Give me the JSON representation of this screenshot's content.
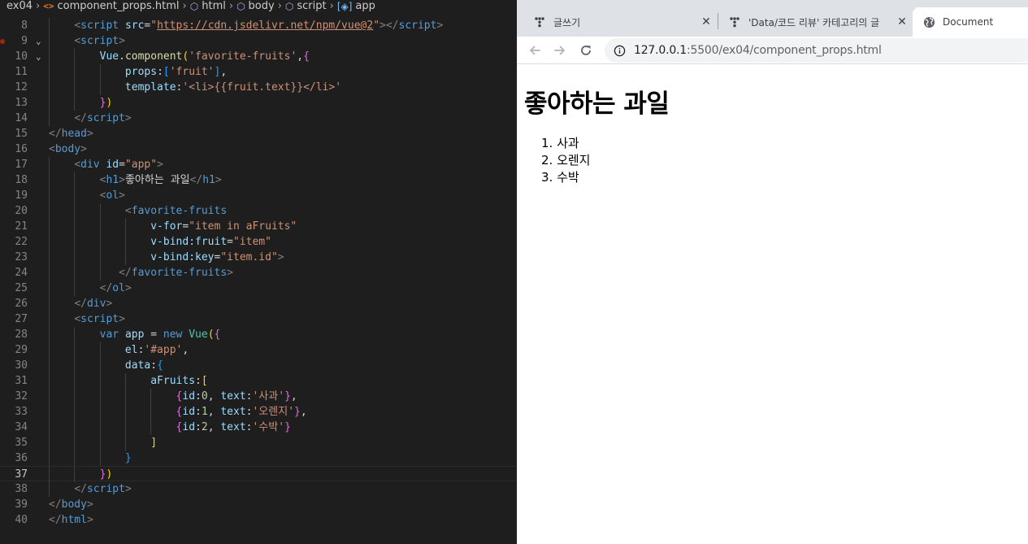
{
  "breadcrumb": [
    {
      "label": "ex04",
      "icon": "none"
    },
    {
      "label": "component_props.html",
      "icon": "html-file-icon"
    },
    {
      "label": "html",
      "icon": "element-icon"
    },
    {
      "label": "body",
      "icon": "element-icon"
    },
    {
      "label": "script",
      "icon": "element-icon"
    },
    {
      "label": "app",
      "icon": "variable-icon"
    }
  ],
  "editor": {
    "current_line": 37,
    "breakpoint_line": 9,
    "lines": [
      {
        "n": 8,
        "tokens": [
          [
            "    ",
            "txt"
          ],
          [
            "<",
            "punc"
          ],
          [
            "script",
            "tag"
          ],
          [
            " ",
            "txt"
          ],
          [
            "src",
            "attr"
          ],
          [
            "=",
            "txt"
          ],
          [
            "\"",
            "str"
          ],
          [
            "https://cdn.jsdelivr.net/npm/vue@2",
            "url"
          ],
          [
            "\"",
            "str"
          ],
          [
            "></",
            "punc"
          ],
          [
            "script",
            "tag"
          ],
          [
            ">",
            "punc"
          ]
        ]
      },
      {
        "n": 9,
        "tokens": [
          [
            "    ",
            "txt"
          ],
          [
            "<",
            "punc"
          ],
          [
            "script",
            "tag"
          ],
          [
            ">",
            "punc"
          ]
        ]
      },
      {
        "n": 10,
        "tokens": [
          [
            "        ",
            "txt"
          ],
          [
            "Vue",
            "var"
          ],
          [
            ".",
            "txt"
          ],
          [
            "component",
            "fn"
          ],
          [
            "(",
            "b1"
          ],
          [
            "'favorite-fruits'",
            "str"
          ],
          [
            ",",
            "txt"
          ],
          [
            "{",
            "b2"
          ]
        ]
      },
      {
        "n": 11,
        "tokens": [
          [
            "            ",
            "txt"
          ],
          [
            "props",
            "var"
          ],
          [
            ":",
            "txt"
          ],
          [
            "[",
            "b3"
          ],
          [
            "'fruit'",
            "str"
          ],
          [
            "]",
            "b3"
          ],
          [
            ",",
            "txt"
          ]
        ]
      },
      {
        "n": 12,
        "tokens": [
          [
            "            ",
            "txt"
          ],
          [
            "template",
            "var"
          ],
          [
            ":",
            "txt"
          ],
          [
            "'<li>{{fruit.text}}</li>'",
            "str"
          ]
        ]
      },
      {
        "n": 13,
        "tokens": [
          [
            "        ",
            "txt"
          ],
          [
            "}",
            "b2"
          ],
          [
            ")",
            "b1"
          ]
        ]
      },
      {
        "n": 14,
        "tokens": [
          [
            "    ",
            "txt"
          ],
          [
            "</",
            "punc"
          ],
          [
            "script",
            "tag"
          ],
          [
            ">",
            "punc"
          ]
        ]
      },
      {
        "n": 15,
        "tokens": [
          [
            "</",
            "punc"
          ],
          [
            "head",
            "tag"
          ],
          [
            ">",
            "punc"
          ]
        ]
      },
      {
        "n": 16,
        "tokens": [
          [
            "<",
            "punc"
          ],
          [
            "body",
            "tag"
          ],
          [
            ">",
            "punc"
          ]
        ]
      },
      {
        "n": 17,
        "tokens": [
          [
            "    ",
            "txt"
          ],
          [
            "<",
            "punc"
          ],
          [
            "div",
            "tag"
          ],
          [
            " ",
            "txt"
          ],
          [
            "id",
            "attr"
          ],
          [
            "=",
            "txt"
          ],
          [
            "\"app\"",
            "str"
          ],
          [
            ">",
            "punc"
          ]
        ]
      },
      {
        "n": 18,
        "tokens": [
          [
            "        ",
            "txt"
          ],
          [
            "<",
            "punc"
          ],
          [
            "h1",
            "tag"
          ],
          [
            ">",
            "punc"
          ],
          [
            "좋아하는 과일",
            "txt"
          ],
          [
            "</",
            "punc"
          ],
          [
            "h1",
            "tag"
          ],
          [
            ">",
            "punc"
          ]
        ]
      },
      {
        "n": 19,
        "tokens": [
          [
            "        ",
            "txt"
          ],
          [
            "<",
            "punc"
          ],
          [
            "ol",
            "tag"
          ],
          [
            ">",
            "punc"
          ]
        ]
      },
      {
        "n": 20,
        "tokens": [
          [
            "            ",
            "txt"
          ],
          [
            "<",
            "punc"
          ],
          [
            "favorite-fruits",
            "tag"
          ]
        ]
      },
      {
        "n": 21,
        "tokens": [
          [
            "                ",
            "txt"
          ],
          [
            "v-for",
            "attr"
          ],
          [
            "=",
            "txt"
          ],
          [
            "\"item in aFruits\"",
            "str"
          ]
        ]
      },
      {
        "n": 22,
        "tokens": [
          [
            "                ",
            "txt"
          ],
          [
            "v-bind:fruit",
            "attr"
          ],
          [
            "=",
            "txt"
          ],
          [
            "\"item\"",
            "str"
          ]
        ]
      },
      {
        "n": 23,
        "tokens": [
          [
            "                ",
            "txt"
          ],
          [
            "v-bind:key",
            "attr"
          ],
          [
            "=",
            "txt"
          ],
          [
            "\"item.id\"",
            "str"
          ],
          [
            ">",
            "punc"
          ]
        ]
      },
      {
        "n": 24,
        "tokens": [
          [
            "           ",
            "txt"
          ],
          [
            "</",
            "punc"
          ],
          [
            "favorite-fruits",
            "tag"
          ],
          [
            ">",
            "punc"
          ]
        ]
      },
      {
        "n": 25,
        "tokens": [
          [
            "        ",
            "txt"
          ],
          [
            "</",
            "punc"
          ],
          [
            "ol",
            "tag"
          ],
          [
            ">",
            "punc"
          ]
        ]
      },
      {
        "n": 26,
        "tokens": [
          [
            "    ",
            "txt"
          ],
          [
            "</",
            "punc"
          ],
          [
            "div",
            "tag"
          ],
          [
            ">",
            "punc"
          ]
        ]
      },
      {
        "n": 27,
        "tokens": [
          [
            "    ",
            "txt"
          ],
          [
            "<",
            "punc"
          ],
          [
            "script",
            "tag"
          ],
          [
            ">",
            "punc"
          ]
        ]
      },
      {
        "n": 28,
        "tokens": [
          [
            "        ",
            "txt"
          ],
          [
            "var",
            "kw"
          ],
          [
            " ",
            "txt"
          ],
          [
            "app",
            "var"
          ],
          [
            " = ",
            "txt"
          ],
          [
            "new",
            "kw"
          ],
          [
            " ",
            "txt"
          ],
          [
            "Vue",
            "cls"
          ],
          [
            "(",
            "b1"
          ],
          [
            "{",
            "b2"
          ]
        ]
      },
      {
        "n": 29,
        "tokens": [
          [
            "            ",
            "txt"
          ],
          [
            "el",
            "var"
          ],
          [
            ":",
            "txt"
          ],
          [
            "'#app'",
            "str"
          ],
          [
            ",",
            "txt"
          ]
        ]
      },
      {
        "n": 30,
        "tokens": [
          [
            "            ",
            "txt"
          ],
          [
            "data",
            "var"
          ],
          [
            ":",
            "txt"
          ],
          [
            "{",
            "b3"
          ]
        ]
      },
      {
        "n": 31,
        "tokens": [
          [
            "                ",
            "txt"
          ],
          [
            "aFruits",
            "var"
          ],
          [
            ":",
            "txt"
          ],
          [
            "[",
            "b1"
          ]
        ]
      },
      {
        "n": 32,
        "tokens": [
          [
            "                    ",
            "txt"
          ],
          [
            "{",
            "b2"
          ],
          [
            "id",
            "var"
          ],
          [
            ":",
            "txt"
          ],
          [
            "0",
            "num"
          ],
          [
            ", ",
            "txt"
          ],
          [
            "text",
            "var"
          ],
          [
            ":",
            "txt"
          ],
          [
            "'사과'",
            "str"
          ],
          [
            "}",
            "b2"
          ],
          [
            ",",
            "txt"
          ]
        ]
      },
      {
        "n": 33,
        "tokens": [
          [
            "                    ",
            "txt"
          ],
          [
            "{",
            "b2"
          ],
          [
            "id",
            "var"
          ],
          [
            ":",
            "txt"
          ],
          [
            "1",
            "num"
          ],
          [
            ", ",
            "txt"
          ],
          [
            "text",
            "var"
          ],
          [
            ":",
            "txt"
          ],
          [
            "'오렌지'",
            "str"
          ],
          [
            "}",
            "b2"
          ],
          [
            ",",
            "txt"
          ]
        ]
      },
      {
        "n": 34,
        "tokens": [
          [
            "                    ",
            "txt"
          ],
          [
            "{",
            "b2"
          ],
          [
            "id",
            "var"
          ],
          [
            ":",
            "txt"
          ],
          [
            "2",
            "num"
          ],
          [
            ", ",
            "txt"
          ],
          [
            "text",
            "var"
          ],
          [
            ":",
            "txt"
          ],
          [
            "'수박'",
            "str"
          ],
          [
            "}",
            "b2"
          ]
        ]
      },
      {
        "n": 35,
        "tokens": [
          [
            "                ",
            "txt"
          ],
          [
            "]",
            "b1"
          ]
        ]
      },
      {
        "n": 36,
        "tokens": [
          [
            "            ",
            "txt"
          ],
          [
            "}",
            "b3"
          ]
        ]
      },
      {
        "n": 37,
        "tokens": [
          [
            "        ",
            "txt"
          ],
          [
            "}",
            "b2"
          ],
          [
            ")",
            "b1"
          ]
        ]
      },
      {
        "n": 38,
        "tokens": [
          [
            "    ",
            "txt"
          ],
          [
            "</",
            "punc"
          ],
          [
            "script",
            "tag"
          ],
          [
            ">",
            "punc"
          ]
        ]
      },
      {
        "n": 39,
        "tokens": [
          [
            "</",
            "punc"
          ],
          [
            "body",
            "tag"
          ],
          [
            ">",
            "punc"
          ]
        ]
      },
      {
        "n": 40,
        "tokens": [
          [
            "</",
            "punc"
          ],
          [
            "html",
            "tag"
          ],
          [
            ">",
            "punc"
          ]
        ]
      }
    ]
  },
  "browser": {
    "tabs": [
      {
        "title": "글쓰기",
        "icon": "tistory-icon",
        "active": false
      },
      {
        "title": "'Data/코드 리뷰' 카테고리의 글",
        "icon": "tistory-icon",
        "active": false
      },
      {
        "title": "Document",
        "icon": "globe-icon",
        "active": true
      }
    ],
    "url_host": "127.0.0.1",
    "url_rest": ":5500/ex04/component_props.html",
    "page": {
      "heading": "좋아하는 과일",
      "items": [
        "1. 사과",
        "2. 오렌지",
        "3. 수박"
      ]
    }
  },
  "colors": {
    "editor_bg": "#1e1e1e",
    "tabstrip_bg": "#dee1e6",
    "omnibox_bg": "#f1f3f4"
  }
}
